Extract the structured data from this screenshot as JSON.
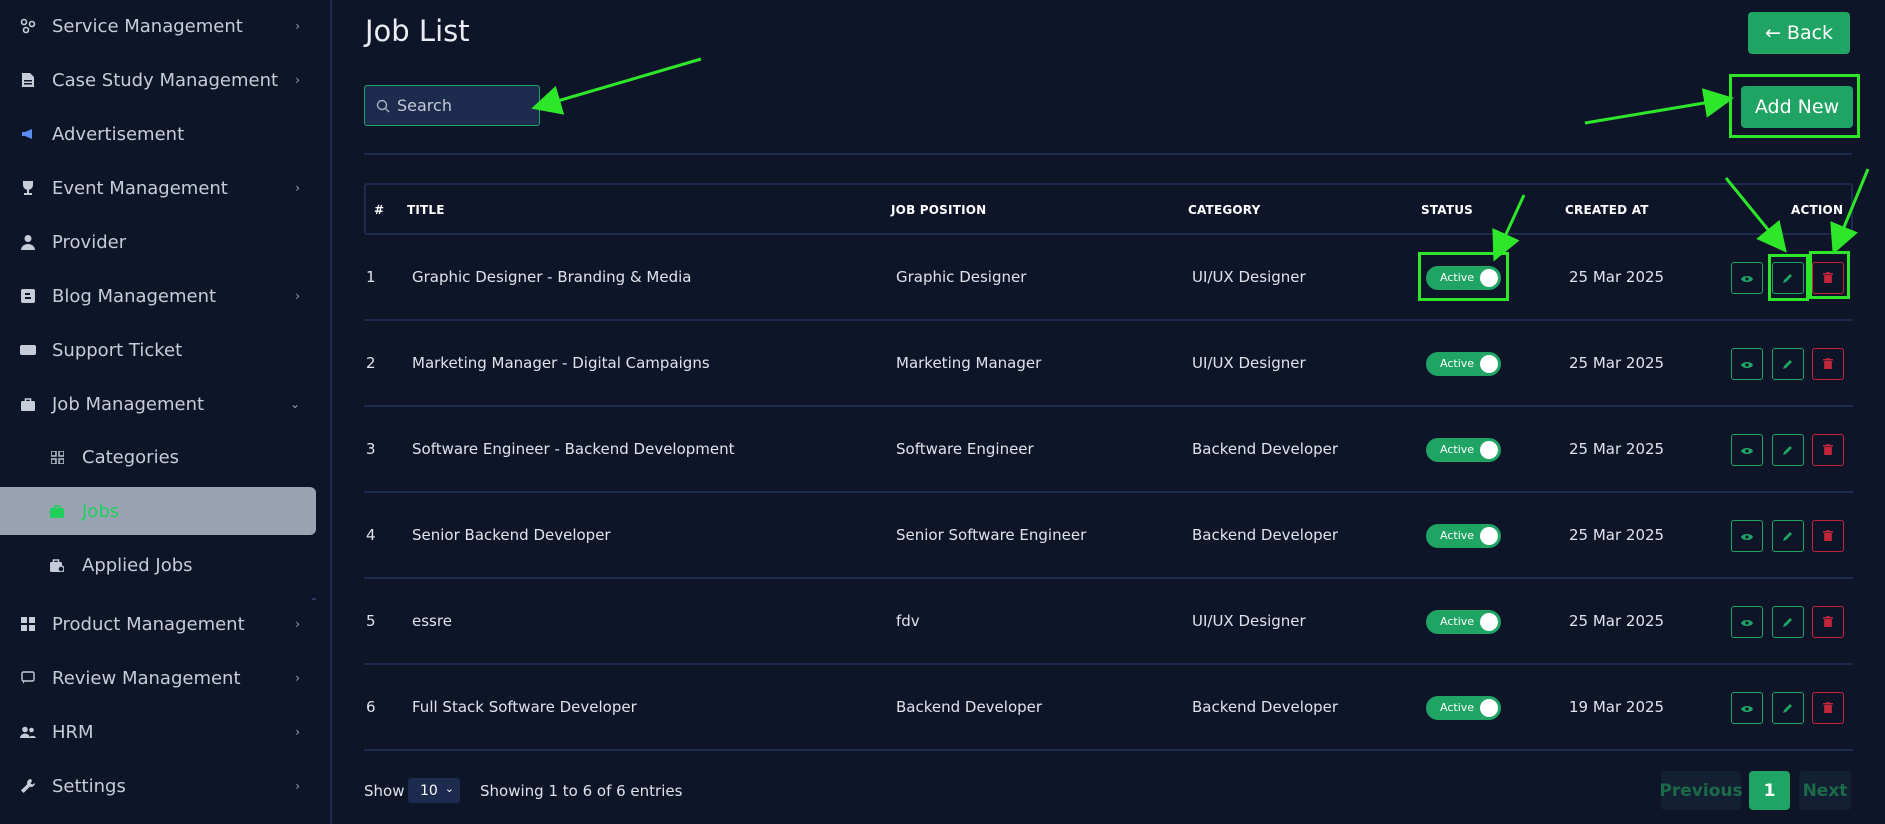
{
  "sidebar": {
    "items": [
      {
        "label": "Service Management",
        "icon": "nodes-icon",
        "chevron": "›"
      },
      {
        "label": "Case Study Management",
        "icon": "document-icon",
        "chevron": "›"
      },
      {
        "label": "Advertisement",
        "icon": "megaphone-icon",
        "chevron": ""
      },
      {
        "label": "Event Management",
        "icon": "trophy-icon",
        "chevron": "›"
      },
      {
        "label": "Provider",
        "icon": "user-icon",
        "chevron": ""
      },
      {
        "label": "Blog Management",
        "icon": "blog-icon",
        "chevron": "›"
      },
      {
        "label": "Support Ticket",
        "icon": "ticket-icon",
        "chevron": ""
      },
      {
        "label": "Job Management",
        "icon": "briefcase-icon",
        "chevron": "⌄"
      },
      {
        "label": "Categories",
        "icon": "grid-icon",
        "chevron": ""
      },
      {
        "label": "Jobs",
        "icon": "briefcase-icon",
        "chevron": ""
      },
      {
        "label": "Applied Jobs",
        "icon": "briefcase-check-icon",
        "chevron": ""
      },
      {
        "label": "Product Management",
        "icon": "grid-icon",
        "chevron": "›"
      },
      {
        "label": "Review Management",
        "icon": "review-icon",
        "chevron": "›"
      },
      {
        "label": "HRM",
        "icon": "users-icon",
        "chevron": "›"
      },
      {
        "label": "Settings",
        "icon": "wrench-icon",
        "chevron": "›"
      }
    ]
  },
  "header": {
    "title": "Job List",
    "back_label": "← Back",
    "add_label": "Add New"
  },
  "search": {
    "placeholder": "Search"
  },
  "table": {
    "columns": [
      "#",
      "TITLE",
      "JOB POSITION",
      "CATEGORY",
      "STATUS",
      "CREATED AT",
      "ACTION"
    ],
    "rows": [
      {
        "num": "1",
        "title": "Graphic Designer - Branding & Media",
        "position": "Graphic Designer",
        "category": "UI/UX Designer",
        "status": "Active",
        "created": "25 Mar 2025"
      },
      {
        "num": "2",
        "title": "Marketing Manager - Digital Campaigns",
        "position": "Marketing Manager",
        "category": "UI/UX Designer",
        "status": "Active",
        "created": "25 Mar 2025"
      },
      {
        "num": "3",
        "title": "Software Engineer - Backend Development",
        "position": "Software Engineer",
        "category": "Backend Developer",
        "status": "Active",
        "created": "25 Mar 2025"
      },
      {
        "num": "4",
        "title": "Senior Backend Developer",
        "position": "Senior Software Engineer",
        "category": "Backend Developer",
        "status": "Active",
        "created": "25 Mar 2025"
      },
      {
        "num": "5",
        "title": "essre",
        "position": "fdv",
        "category": "UI/UX Designer",
        "status": "Active",
        "created": "25 Mar 2025"
      },
      {
        "num": "6",
        "title": "Full Stack Software Developer",
        "position": "Backend Developer",
        "category": "Backend Developer",
        "status": "Active",
        "created": "19 Mar 2025"
      }
    ]
  },
  "footer": {
    "show_label": "Show",
    "page_size": "10",
    "info": "Showing 1 to 6 of 6 entries",
    "prev_label": "Previous",
    "page": "1",
    "next_label": "Next"
  },
  "colors": {
    "accent": "#1fa463",
    "danger": "#c3263a",
    "annotation": "#2ee62a",
    "background": "#0e1529"
  }
}
